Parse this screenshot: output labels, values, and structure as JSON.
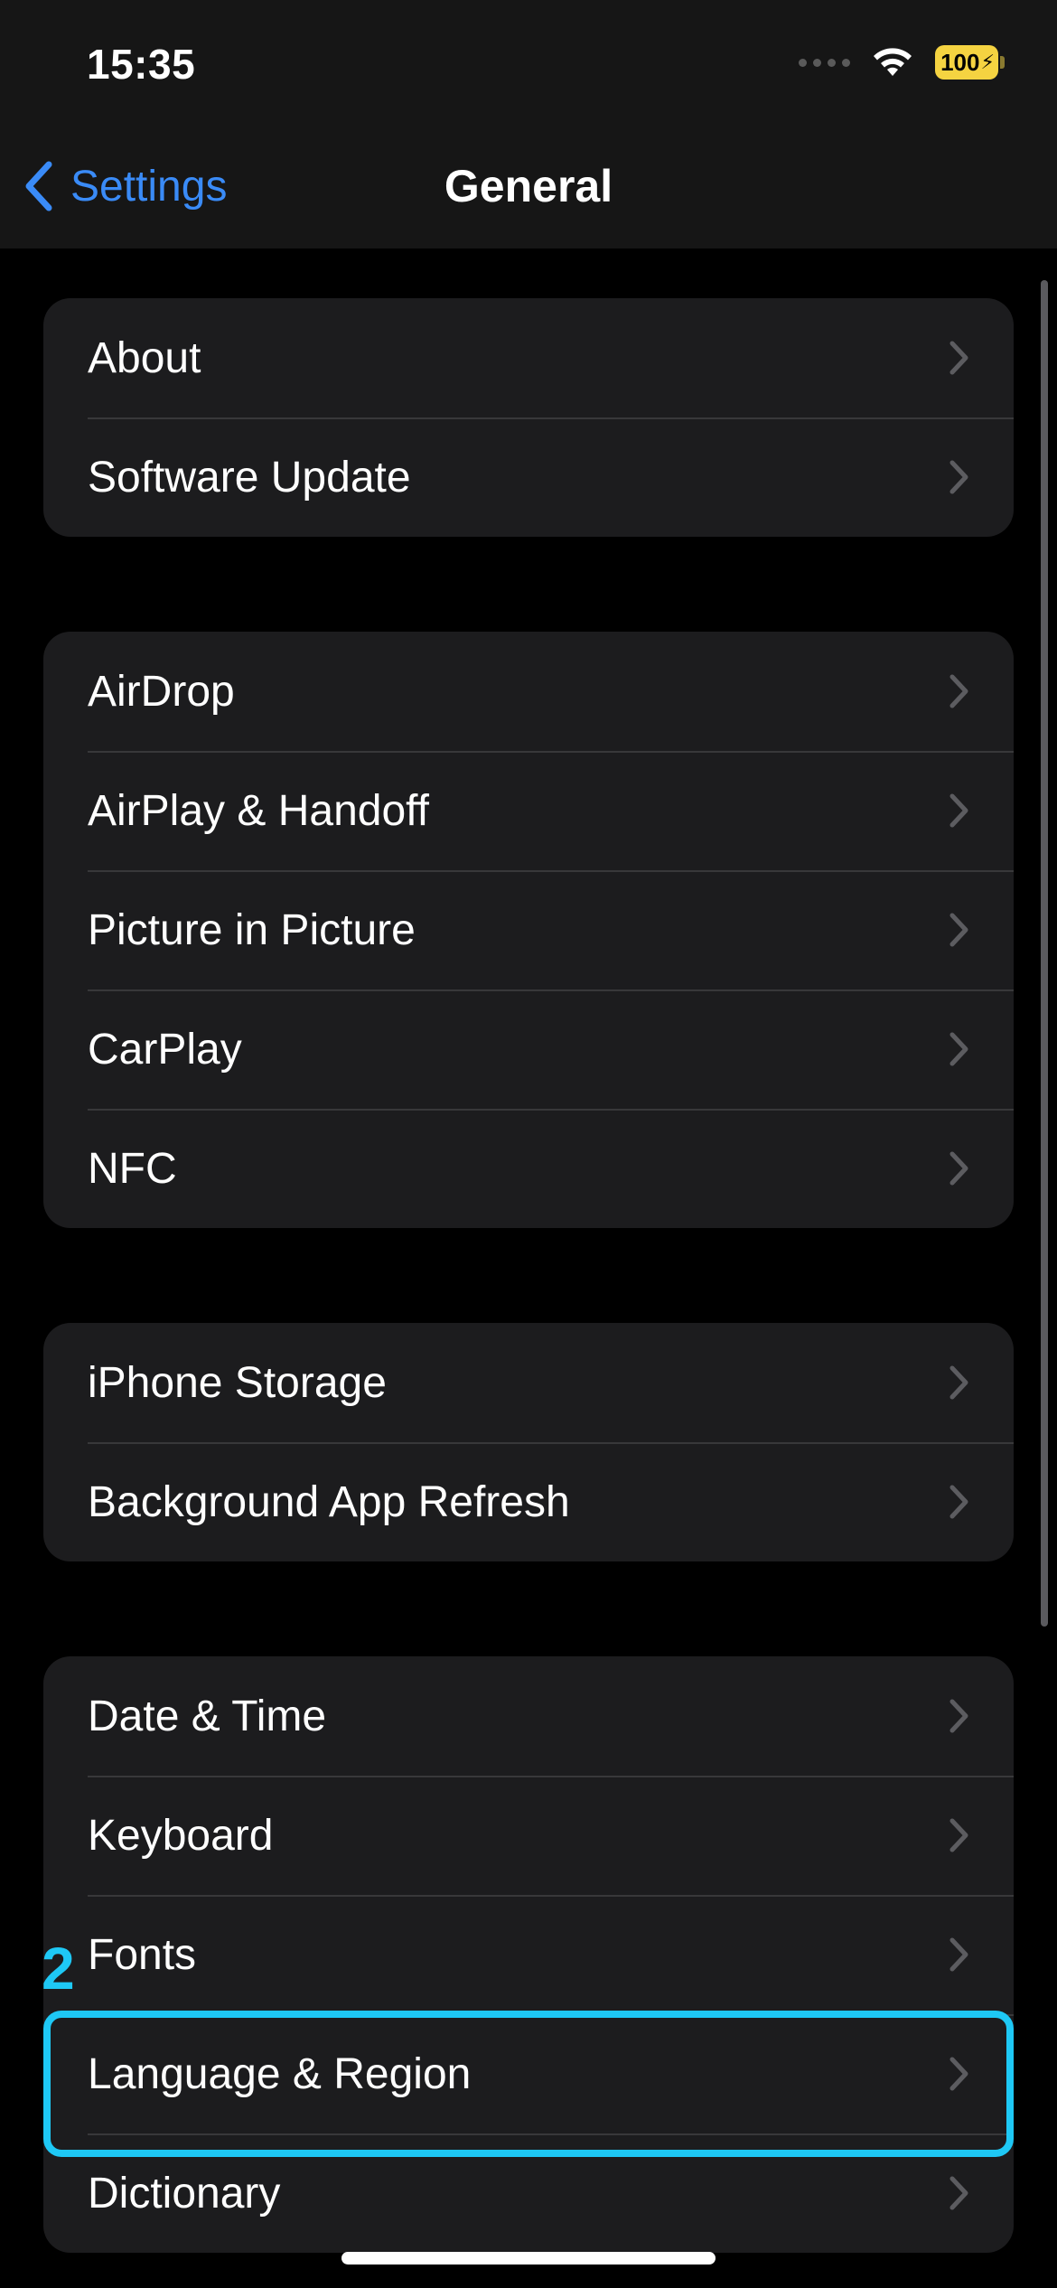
{
  "status_bar": {
    "time": "15:35",
    "battery_level": "100",
    "battery_color": "#f5d341"
  },
  "nav": {
    "back_label": "Settings",
    "title": "General",
    "accent_color": "#3a8bf7"
  },
  "groups": [
    {
      "items": [
        "About",
        "Software Update"
      ]
    },
    {
      "items": [
        "AirDrop",
        "AirPlay & Handoff",
        "Picture in Picture",
        "CarPlay",
        "NFC"
      ]
    },
    {
      "items": [
        "iPhone Storage",
        "Background App Refresh"
      ]
    },
    {
      "items": [
        "Date & Time",
        "Keyboard",
        "Fonts",
        "Language & Region",
        "Dictionary"
      ]
    }
  ],
  "annotation": {
    "number": "2",
    "target": "Language & Region",
    "color": "#1ec8f5"
  }
}
